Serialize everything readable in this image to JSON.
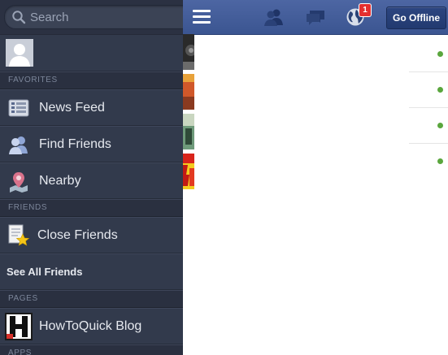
{
  "search": {
    "placeholder": "Search"
  },
  "sections": {
    "favorites": "FAVORITES",
    "friends": "FRIENDS",
    "pages": "PAGES",
    "apps": "APPS"
  },
  "favorites": [
    {
      "label": "News Feed",
      "icon": "news-feed-icon"
    },
    {
      "label": "Find Friends",
      "icon": "find-friends-icon"
    },
    {
      "label": "Nearby",
      "icon": "map-pin-icon"
    }
  ],
  "friends": {
    "close_friends": "Close Friends",
    "see_all": "See All Friends"
  },
  "pages": [
    {
      "label": "HowToQuick Blog",
      "icon": "howtoquick-logo"
    }
  ],
  "topbar": {
    "notification_count": "1",
    "go_offline": "Go Offline"
  },
  "colors": {
    "sidebar": "#323a4c",
    "topbar": "#3b5591",
    "online": "#5aa63d",
    "badge": "#e42f2f"
  }
}
